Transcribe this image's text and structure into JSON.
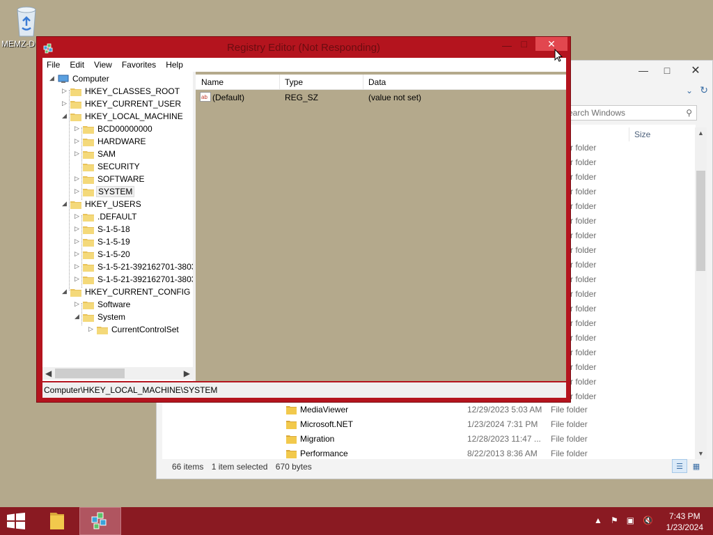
{
  "desktop": {
    "recycle_bin_label": "MEMZ-D"
  },
  "explorer": {
    "search_placeholder": "earch Windows",
    "size_header": "Size",
    "partial_rows": [
      {
        "type": "r folder"
      },
      {
        "type": "r folder"
      },
      {
        "type": "r folder"
      },
      {
        "type": "r folder"
      },
      {
        "type": "r folder"
      },
      {
        "type": "r folder"
      },
      {
        "type": "r folder"
      },
      {
        "type": "r folder"
      },
      {
        "type": "r folder"
      },
      {
        "type": "r folder"
      },
      {
        "type": "r folder"
      },
      {
        "type": "r folder"
      },
      {
        "type": "r folder"
      },
      {
        "type": "r folder"
      },
      {
        "type": "r folder"
      },
      {
        "type": "r folder"
      },
      {
        "type": "r folder"
      },
      {
        "type": "r folder"
      }
    ],
    "rows": [
      {
        "name": "MediaViewer",
        "date": "12/29/2023 5:03 AM",
        "type": "File folder"
      },
      {
        "name": "Microsoft.NET",
        "date": "1/23/2024 7:31 PM",
        "type": "File folder"
      },
      {
        "name": "Migration",
        "date": "12/28/2023 11:47 ...",
        "type": "File folder"
      },
      {
        "name": "Performance",
        "date": "8/22/2013 8:36 AM",
        "type": "File folder"
      }
    ],
    "status": {
      "items": "66 items",
      "selected": "1 item selected",
      "size": "670 bytes"
    }
  },
  "regedit": {
    "title": "Registry Editor (Not Responding)",
    "menu": [
      "File",
      "Edit",
      "View",
      "Favorites",
      "Help"
    ],
    "tree": {
      "computer": "Computer",
      "hkcr": "HKEY_CLASSES_ROOT",
      "hkcu": "HKEY_CURRENT_USER",
      "hklm": "HKEY_LOCAL_MACHINE",
      "hklm_children": [
        "BCD00000000",
        "HARDWARE",
        "SAM",
        "SECURITY",
        "SOFTWARE",
        "SYSTEM"
      ],
      "hku": "HKEY_USERS",
      "hku_children": [
        ".DEFAULT",
        "S-1-5-18",
        "S-1-5-19",
        "S-1-5-20",
        "S-1-5-21-392162701-3803",
        "S-1-5-21-392162701-3803"
      ],
      "hkcc": "HKEY_CURRENT_CONFIG",
      "hkcc_children": [
        "Software",
        "System"
      ],
      "system_children": [
        "CurrentControlSet"
      ]
    },
    "columns": {
      "name": "Name",
      "type": "Type",
      "data": "Data"
    },
    "values": [
      {
        "name": "(Default)",
        "type": "REG_SZ",
        "data": "(value not set)"
      }
    ],
    "status_path": "Computer\\HKEY_LOCAL_MACHINE\\SYSTEM"
  },
  "taskbar": {
    "time": "7:43 PM",
    "date": "1/23/2024"
  }
}
